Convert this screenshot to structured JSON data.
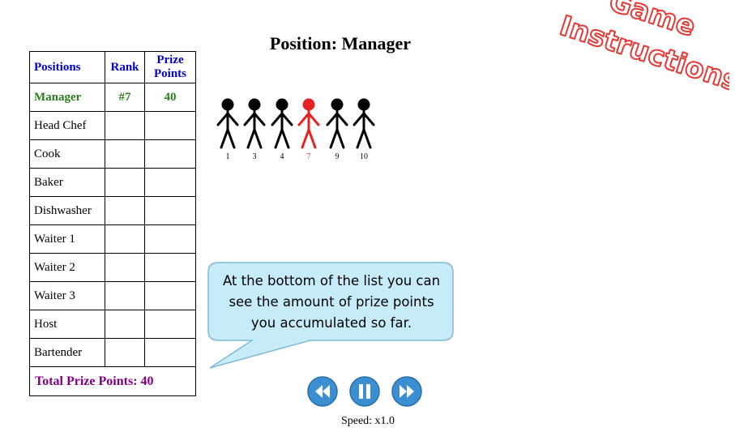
{
  "title": "Position: Manager",
  "table": {
    "headers": {
      "positions": "Positions",
      "rank": "Rank",
      "prize_points_line1": "Prize",
      "prize_points_line2": "Points"
    },
    "rows": [
      {
        "position": "Manager",
        "rank": "#7",
        "points": "40",
        "current": true
      },
      {
        "position": "Head Chef",
        "rank": "",
        "points": ""
      },
      {
        "position": "Cook",
        "rank": "",
        "points": ""
      },
      {
        "position": "Baker",
        "rank": "",
        "points": ""
      },
      {
        "position": "Dishwasher",
        "rank": "",
        "points": ""
      },
      {
        "position": "Waiter 1",
        "rank": "",
        "points": ""
      },
      {
        "position": "Waiter 2",
        "rank": "",
        "points": ""
      },
      {
        "position": "Waiter 3",
        "rank": "",
        "points": ""
      },
      {
        "position": "Host",
        "rank": "",
        "points": ""
      },
      {
        "position": "Bartender",
        "rank": "",
        "points": ""
      }
    ],
    "total": "Total Prize Points: 40"
  },
  "figures": [
    {
      "number": "1",
      "active": false
    },
    {
      "number": "3",
      "active": false
    },
    {
      "number": "4",
      "active": false
    },
    {
      "number": "7",
      "active": true
    },
    {
      "number": "9",
      "active": false
    },
    {
      "number": "10",
      "active": false
    }
  ],
  "instructions": {
    "line1": "Game",
    "line2": "Instructions"
  },
  "callout": {
    "text": "At the bottom of the list you can see the amount of prize points you accumulated so far."
  },
  "controls": {
    "rewind_icon": "rewind-icon",
    "pause_icon": "pause-icon",
    "forward_icon": "fast-forward-icon",
    "speed": "Speed: x1.0"
  },
  "colors": {
    "active_figure": "#e52222",
    "header_text": "#0000cc",
    "current_row": "#2e7d1e",
    "total_text": "#800080",
    "instructions_text": "#e53935",
    "callout_fill": "#c6ecfa",
    "button_fill": "#3b8fd0"
  }
}
